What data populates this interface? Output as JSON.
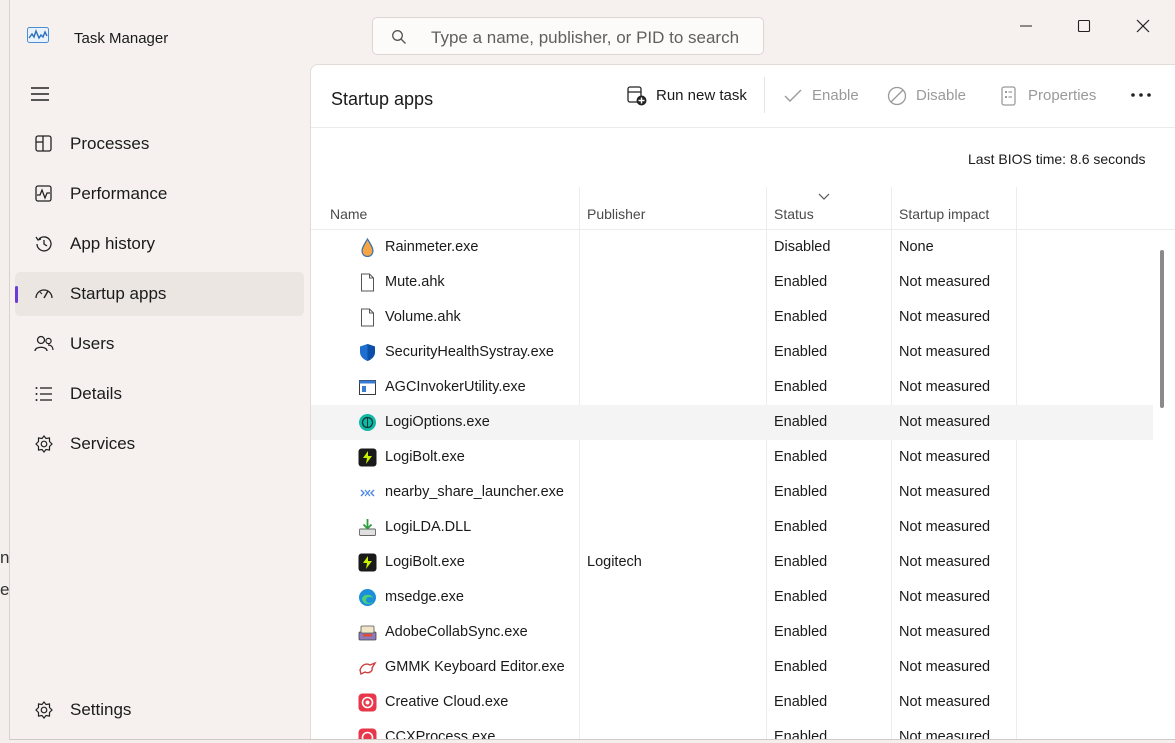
{
  "background_fragments": [
    "n",
    "e"
  ],
  "window": {
    "title": "Task Manager",
    "search_placeholder": "Type a name, publisher, or PID to search"
  },
  "nav": {
    "items": [
      {
        "label": "Processes",
        "icon": "processes-icon"
      },
      {
        "label": "Performance",
        "icon": "performance-icon"
      },
      {
        "label": "App history",
        "icon": "app-history-icon"
      },
      {
        "label": "Startup apps",
        "icon": "startup-apps-icon",
        "active": true
      },
      {
        "label": "Users",
        "icon": "users-icon"
      },
      {
        "label": "Details",
        "icon": "details-icon"
      },
      {
        "label": "Services",
        "icon": "services-icon"
      }
    ],
    "settings_label": "Settings"
  },
  "toolbar": {
    "title": "Startup apps",
    "run_new_task": "Run new task",
    "enable": "Enable",
    "disable": "Disable",
    "properties": "Properties"
  },
  "bios": {
    "label": "Last BIOS time:",
    "value": "8.6 seconds"
  },
  "table": {
    "columns": [
      "Name",
      "Publisher",
      "Status",
      "Startup impact"
    ],
    "rows": [
      {
        "name": "Rainmeter.exe",
        "publisher": "",
        "status": "Disabled",
        "impact": "None",
        "icon": "rainmeter-icon"
      },
      {
        "name": "Mute.ahk",
        "publisher": "",
        "status": "Enabled",
        "impact": "Not measured",
        "icon": "file-icon"
      },
      {
        "name": "Volume.ahk",
        "publisher": "",
        "status": "Enabled",
        "impact": "Not measured",
        "icon": "file-icon"
      },
      {
        "name": "SecurityHealthSystray.exe",
        "publisher": "",
        "status": "Enabled",
        "impact": "Not measured",
        "icon": "shield-icon"
      },
      {
        "name": "AGCInvokerUtility.exe",
        "publisher": "",
        "status": "Enabled",
        "impact": "Not measured",
        "icon": "window-app-icon"
      },
      {
        "name": "LogiOptions.exe",
        "publisher": "",
        "status": "Enabled",
        "impact": "Not measured",
        "icon": "logioptions-icon"
      },
      {
        "name": "LogiBolt.exe",
        "publisher": "",
        "status": "Enabled",
        "impact": "Not measured",
        "icon": "logibolt-icon"
      },
      {
        "name": "nearby_share_launcher.exe",
        "publisher": "",
        "status": "Enabled",
        "impact": "Not measured",
        "icon": "nearby-share-icon"
      },
      {
        "name": "LogiLDA.DLL",
        "publisher": "",
        "status": "Enabled",
        "impact": "Not measured",
        "icon": "download-tray-icon"
      },
      {
        "name": "LogiBolt.exe",
        "publisher": "Logitech",
        "status": "Enabled",
        "impact": "Not measured",
        "icon": "logibolt-icon"
      },
      {
        "name": "msedge.exe",
        "publisher": "",
        "status": "Enabled",
        "impact": "Not measured",
        "icon": "edge-icon"
      },
      {
        "name": "AdobeCollabSync.exe",
        "publisher": "",
        "status": "Enabled",
        "impact": "Not measured",
        "icon": "adobe-collab-icon"
      },
      {
        "name": "GMMK Keyboard Editor.exe",
        "publisher": "",
        "status": "Enabled",
        "impact": "Not measured",
        "icon": "gmmk-icon"
      },
      {
        "name": "Creative Cloud.exe",
        "publisher": "",
        "status": "Enabled",
        "impact": "Not measured",
        "icon": "creative-cloud-icon"
      },
      {
        "name": "CCXProcess.exe",
        "publisher": "",
        "status": "Enabled",
        "impact": "Not measured",
        "icon": "ccx-icon"
      }
    ]
  }
}
